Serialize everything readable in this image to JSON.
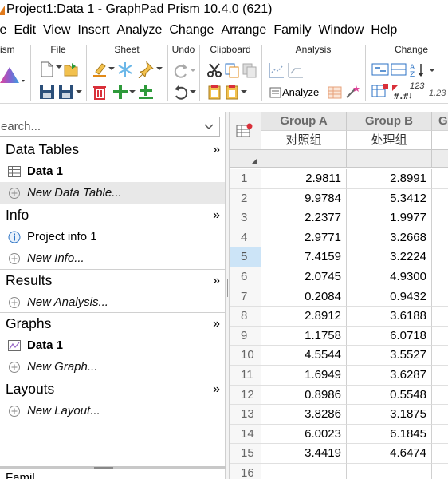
{
  "window": {
    "title": "Project1:Data 1 - GraphPad Prism 10.4.0 (621)"
  },
  "menubar": {
    "items": [
      "le",
      "Edit",
      "View",
      "Insert",
      "Analyze",
      "Change",
      "Arrange",
      "Family",
      "Window",
      "Help"
    ]
  },
  "ribbon": {
    "groups": {
      "prism": "rism",
      "file": "File",
      "sheet": "Sheet",
      "undo": "Undo",
      "clipboard": "Clipboard",
      "analysis": "Analysis",
      "change": "Change"
    },
    "analyze_label": "Analyze",
    "change_num_label": "123",
    "change_num2_label": "1.23",
    "change_hash_label": "#.#",
    "colors": {
      "accent_pink": "#e0449a",
      "accent_green": "#2e9a3a",
      "accent_red": "#d9303a",
      "accent_blue": "#2b72c4",
      "accent_orange": "#e28a17",
      "gray": "#8a8a8a"
    }
  },
  "navigator": {
    "search_placeholder": "earch...",
    "sections": [
      {
        "title": "Data Tables",
        "items": [
          {
            "label": "Data 1",
            "icon": "data-table-icon",
            "bold": true
          },
          {
            "label": "New Data Table...",
            "icon": "add-circle-icon",
            "italic": true,
            "selected": true
          }
        ]
      },
      {
        "title": "Info",
        "items": [
          {
            "label": "Project info 1",
            "icon": "info-icon"
          },
          {
            "label": "New Info...",
            "icon": "add-circle-icon",
            "italic": true
          }
        ]
      },
      {
        "title": "Results",
        "items": [
          {
            "label": "New Analysis...",
            "icon": "add-circle-icon",
            "italic": true
          }
        ]
      },
      {
        "title": "Graphs",
        "items": [
          {
            "label": "Data 1",
            "icon": "graph-icon",
            "bold": true
          },
          {
            "label": "New Graph...",
            "icon": "add-circle-icon",
            "italic": true
          }
        ]
      },
      {
        "title": "Layouts",
        "items": [
          {
            "label": "New Layout...",
            "icon": "add-circle-icon",
            "italic": true
          }
        ]
      }
    ],
    "expand_glyph": "»",
    "bottom_label": "Famil..."
  },
  "grid": {
    "columns": [
      {
        "title": "Group A",
        "subtitle": "对照组"
      },
      {
        "title": "Group B",
        "subtitle": "处理组"
      }
    ],
    "partial_column_letter": "G",
    "selected_row": 5,
    "rows": [
      {
        "n": "1",
        "a": "2.9811",
        "b": "2.8991"
      },
      {
        "n": "2",
        "a": "9.9784",
        "b": "5.3412"
      },
      {
        "n": "3",
        "a": "2.2377",
        "b": "1.9977"
      },
      {
        "n": "4",
        "a": "2.9771",
        "b": "3.2668"
      },
      {
        "n": "5",
        "a": "7.4159",
        "b": "3.2224"
      },
      {
        "n": "6",
        "a": "2.0745",
        "b": "4.9300"
      },
      {
        "n": "7",
        "a": "0.2084",
        "b": "0.9432"
      },
      {
        "n": "8",
        "a": "2.8912",
        "b": "3.6188"
      },
      {
        "n": "9",
        "a": "1.1758",
        "b": "6.0718"
      },
      {
        "n": "10",
        "a": "4.5544",
        "b": "3.5527"
      },
      {
        "n": "11",
        "a": "1.6949",
        "b": "3.6287"
      },
      {
        "n": "12",
        "a": "0.8986",
        "b": "0.5548"
      },
      {
        "n": "13",
        "a": "3.8286",
        "b": "3.1875"
      },
      {
        "n": "14",
        "a": "6.0023",
        "b": "6.1845"
      },
      {
        "n": "15",
        "a": "3.4419",
        "b": "4.6474"
      },
      {
        "n": "16",
        "a": "",
        "b": ""
      }
    ]
  }
}
